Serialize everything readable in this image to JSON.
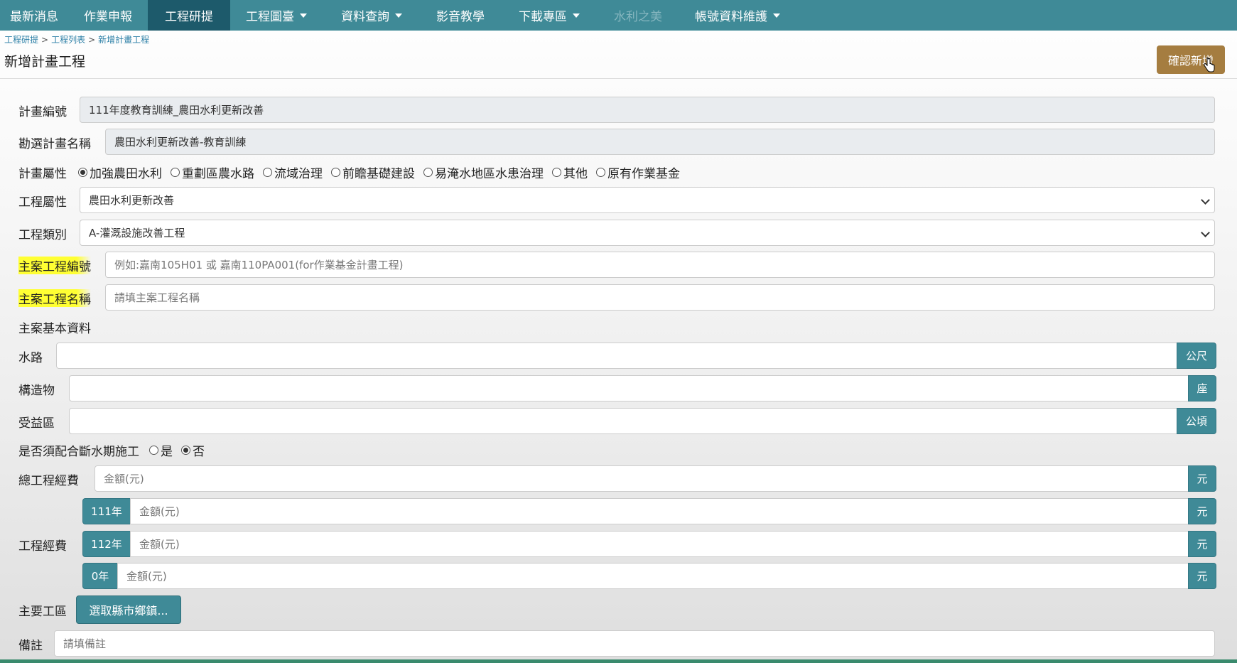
{
  "nav": {
    "items": [
      {
        "label": "最新消息"
      },
      {
        "label": "作業申報"
      },
      {
        "label": "工程研提"
      },
      {
        "label": "工程圖臺"
      },
      {
        "label": "資料查詢"
      },
      {
        "label": "影音教學"
      },
      {
        "label": "下載專區"
      },
      {
        "label": "水利之美"
      },
      {
        "label": "帳號資料維護"
      }
    ]
  },
  "breadcrumb": {
    "items": [
      "工程研提",
      "工程列表",
      "新增計畫工程"
    ],
    "separator": ">"
  },
  "page": {
    "title": "新增計畫工程",
    "confirm_label": "確認新增"
  },
  "form": {
    "plan_code": {
      "label": "計畫編號",
      "value": "111年度教育訓練_農田水利更新改善"
    },
    "selected_plan": {
      "label": "勘選計畫名稱",
      "value": "農田水利更新改善-教育訓練"
    },
    "plan_attr": {
      "label": "計畫屬性",
      "options": [
        "加強農田水利",
        "重劃區農水路",
        "流域治理",
        "前瞻基礎建設",
        "易淹水地區水患治理",
        "其他",
        "原有作業基金"
      ],
      "selected": "加強農田水利"
    },
    "project_attr": {
      "label": "工程屬性",
      "value": "農田水利更新改善"
    },
    "project_type": {
      "label": "工程類別",
      "value": "A-灌溉設施改善工程"
    },
    "main_code": {
      "label": "主案工程編號",
      "placeholder": "例如:嘉南105H01 或 嘉南110PA001(for作業基金計畫工程)"
    },
    "main_name": {
      "label": "主案工程名稱",
      "placeholder": "請填主案工程名稱"
    },
    "basic_section": {
      "label": "主案基本資料"
    },
    "waterway": {
      "label": "水路",
      "unit": "公尺",
      "value": ""
    },
    "structure": {
      "label": "構造物",
      "unit": "座",
      "value": ""
    },
    "benefit_area": {
      "label": "受益區",
      "unit": "公頃",
      "value": ""
    },
    "water_cut": {
      "label": "是否須配合斷水期施工",
      "options": [
        "是",
        "否"
      ],
      "selected": "否"
    },
    "total_cost": {
      "label": "總工程經費",
      "placeholder": "金額(元)",
      "unit": "元"
    },
    "cost": {
      "label": "工程經費",
      "years": [
        {
          "year": "111年",
          "placeholder": "金額(元)",
          "unit": "元"
        },
        {
          "year": "112年",
          "placeholder": "金額(元)",
          "unit": "元"
        },
        {
          "year": "0年",
          "placeholder": "金額(元)",
          "unit": "元"
        }
      ]
    },
    "work_area": {
      "label": "主要工區",
      "button": "選取縣市鄉鎮..."
    },
    "remark": {
      "label": "備註",
      "placeholder": "請填備註"
    }
  }
}
